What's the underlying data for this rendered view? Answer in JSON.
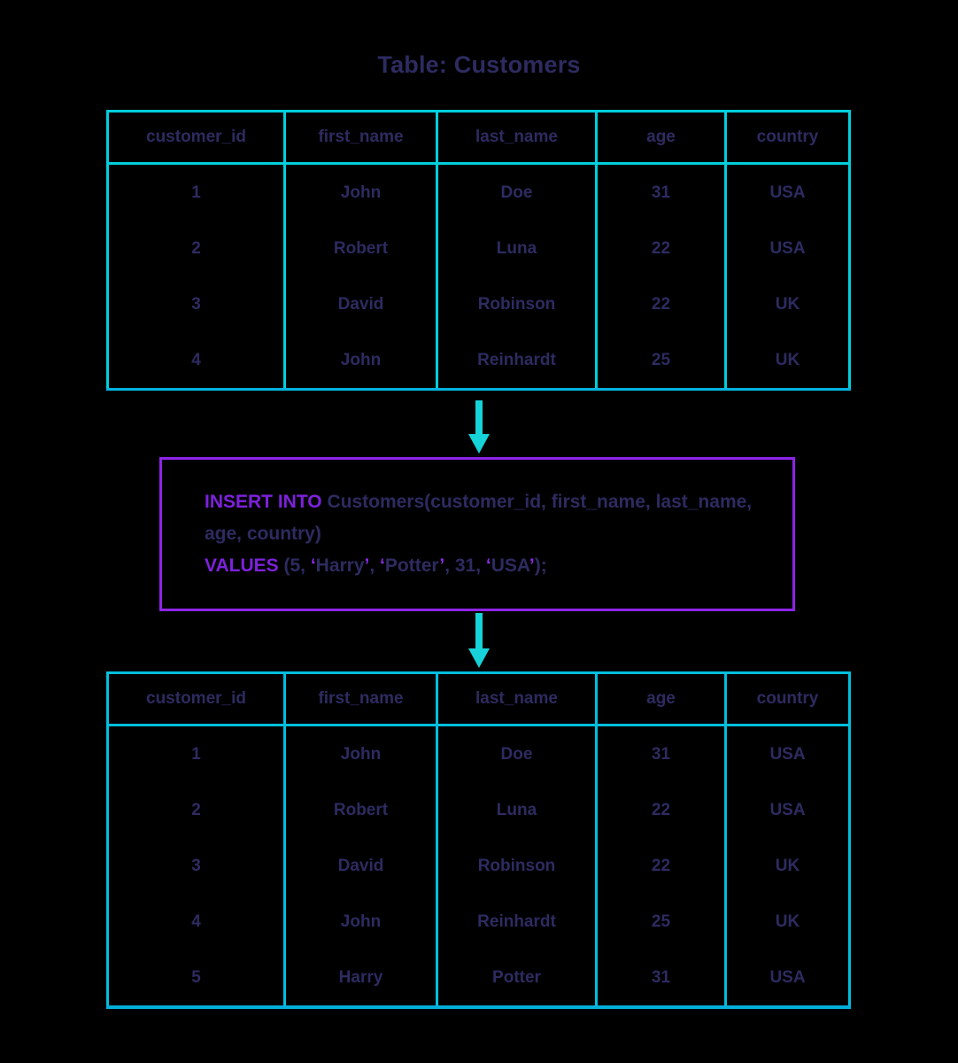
{
  "title": "Table: Customers",
  "colors": {
    "background": "#000000",
    "table_border_top": "#00cfdc",
    "table_border_bottom": "#00bfdd",
    "text": "#2d2b60",
    "sql_box_border": "#8f23e8",
    "sql_keyword": "#7d21dc",
    "sql_quote": "#8a2be8",
    "arrow": "#15d3d8"
  },
  "table_top": {
    "name": "Customers",
    "columns": [
      "customer_id",
      "first_name",
      "last_name",
      "age",
      "country"
    ],
    "rows": [
      [
        "1",
        "John",
        "Doe",
        "31",
        "USA"
      ],
      [
        "2",
        "Robert",
        "Luna",
        "22",
        "USA"
      ],
      [
        "3",
        "David",
        "Robinson",
        "22",
        "UK"
      ],
      [
        "4",
        "John",
        "Reinhardt",
        "25",
        "UK"
      ]
    ]
  },
  "sql": {
    "line1_keyword": "INSERT INTO",
    "line1_rest": " Customers(customer_id, first_name, last_name, age, country)",
    "line2_keyword": "VALUES",
    "line2_open": " (5, ",
    "q1_open": "‘",
    "v1": "Harry",
    "q1_close": "’",
    "sep1": ", ",
    "q2_open": "‘",
    "v2": "Potter",
    "q2_close": "’",
    "sep2": ", 31, ",
    "q3_open": "‘",
    "v3": "USA",
    "q3_close": "’",
    "line2_close": ");",
    "full_text": "INSERT INTO Customers(customer_id, first_name, last_name, age, country) VALUES (5, ‘Harry’, ‘Potter’, 31, ‘USA’);"
  },
  "arrows": [
    {
      "name": "arrow-table-to-sql",
      "direction": "down"
    },
    {
      "name": "arrow-sql-to-table",
      "direction": "down"
    }
  ],
  "table_bottom": {
    "name": "Customers",
    "columns": [
      "customer_id",
      "first_name",
      "last_name",
      "age",
      "country"
    ],
    "rows": [
      [
        "1",
        "John",
        "Doe",
        "31",
        "USA"
      ],
      [
        "2",
        "Robert",
        "Luna",
        "22",
        "USA"
      ],
      [
        "3",
        "David",
        "Robinson",
        "22",
        "UK"
      ],
      [
        "4",
        "John",
        "Reinhardt",
        "25",
        "UK"
      ],
      [
        "5",
        "Harry",
        "Potter",
        "31",
        "USA"
      ]
    ]
  }
}
